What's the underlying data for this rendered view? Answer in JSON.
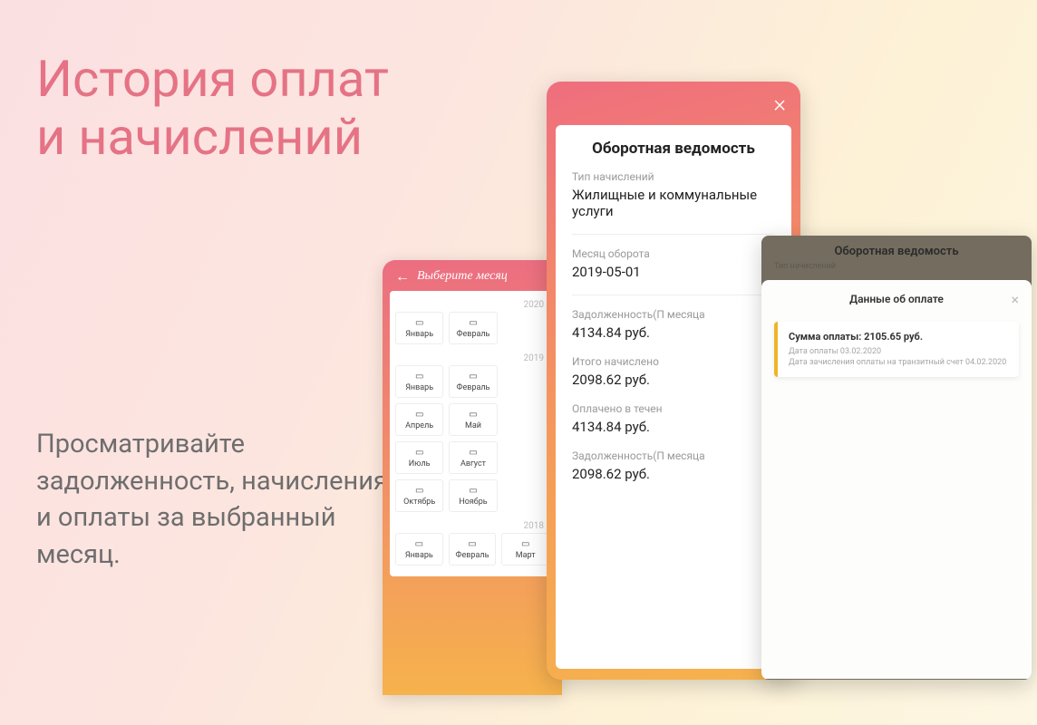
{
  "heading_line1": "История оплат",
  "heading_line2": "и начислений",
  "subheading": "Просматривайте задолженность, начисления и оплаты за выбранный месяц.",
  "monthPicker": {
    "title": "Выберите месяц",
    "years": [
      {
        "year": "2020",
        "months": [
          "Январь",
          "Февраль"
        ]
      },
      {
        "year": "2019",
        "months": [
          "Январь",
          "Февраль",
          null,
          "Апрель",
          "Май",
          null,
          "Июль",
          "Август",
          null,
          "Октябрь",
          "Ноябрь",
          null
        ]
      },
      {
        "year": "2018",
        "months": [
          "Январь",
          "Февраль",
          "Март"
        ]
      }
    ]
  },
  "statement": {
    "title": "Оборотная ведомость",
    "rows": [
      {
        "label": "Тип начислений",
        "value": "Жилищные и коммунальные услуги"
      },
      {
        "label": "Месяц оборота",
        "value": "2019-05-01"
      },
      {
        "label": "Задолженность(П месяца",
        "value": "4134.84 руб."
      },
      {
        "label": "Итого начислено",
        "value": "2098.62 руб."
      },
      {
        "label": "Оплачено в течен",
        "value": "4134.84 руб."
      },
      {
        "label": "Задолженность(П месяца",
        "value": "2098.62 руб."
      }
    ]
  },
  "overlay": {
    "headerTitle": "Оборотная ведомость",
    "headerSub": "Тип начислений",
    "sheetTitle": "Данные об оплате",
    "payment": {
      "amount": "Сумма оплаты: 2105.65 руб.",
      "date": "Дата оплаты 03.02.2020",
      "transit": "Дата зачисления оплаты на транзитный счет 04.02.2020"
    }
  }
}
